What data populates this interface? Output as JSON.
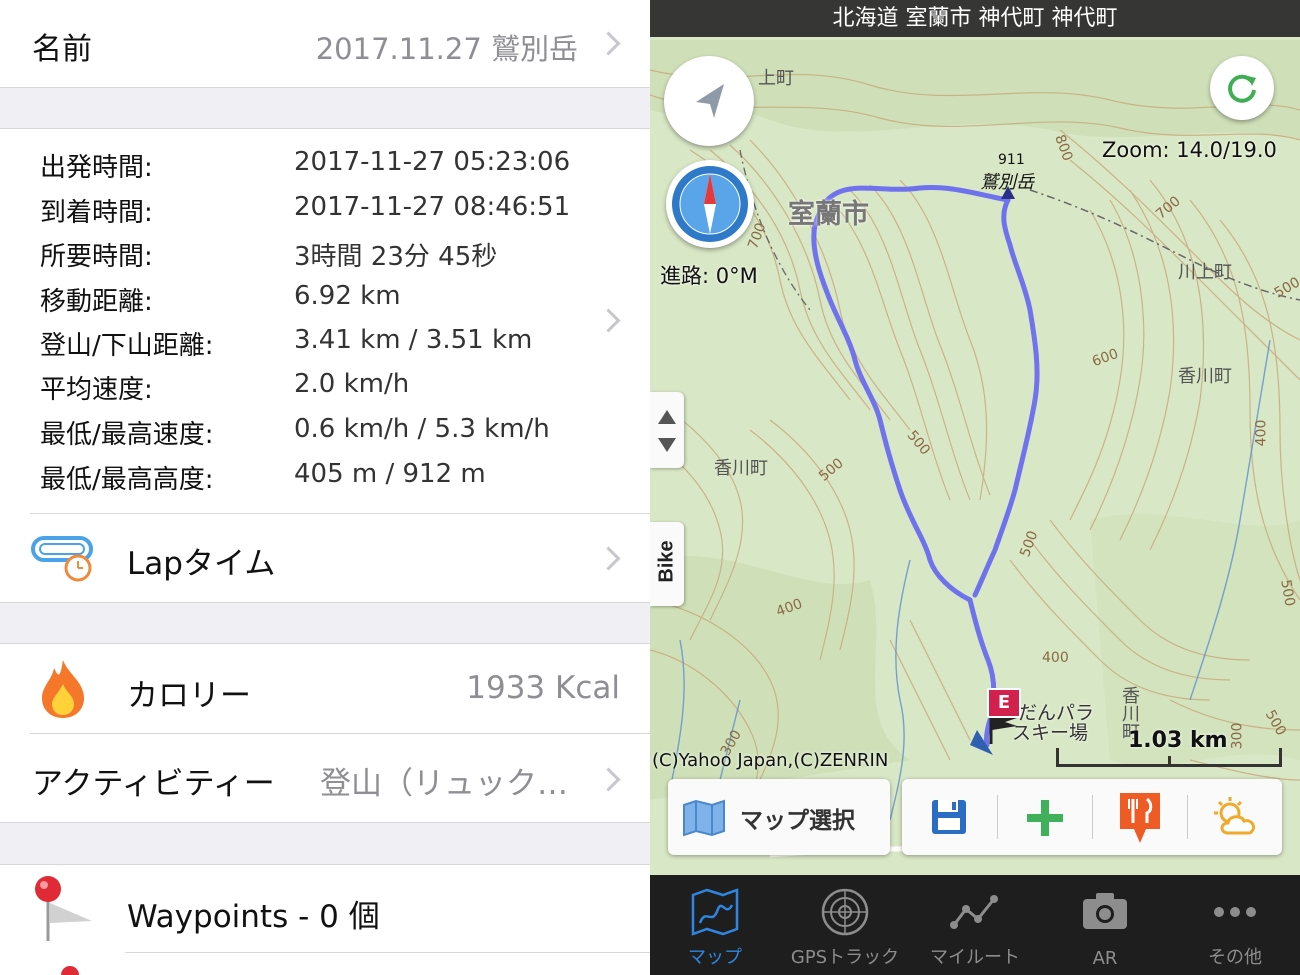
{
  "detail": {
    "name_label": "名前",
    "name_value": "2017.11.27 鷲別岳",
    "stats": [
      {
        "label": "出発時間:",
        "value": "2017-11-27 05:23:06"
      },
      {
        "label": "到着時間:",
        "value": "2017-11-27 08:46:51"
      },
      {
        "label": "所要時間:",
        "value": "3時間 23分 45秒"
      },
      {
        "label": "移動距離:",
        "value": "6.92 km"
      },
      {
        "label": "登山/下山距離:",
        "value": "3.41 km / 3.51 km"
      },
      {
        "label": "平均速度:",
        "value": "2.0 km/h"
      },
      {
        "label": "最低/最高速度:",
        "value": "0.6 km/h / 5.3 km/h"
      },
      {
        "label": "最低/最高高度:",
        "value": "405 m / 912 m"
      }
    ],
    "lap_label": "Lapタイム",
    "calorie_label": "カロリー",
    "calorie_value": "1933 Kcal",
    "activity_label": "アクティビティー",
    "activity_value": "登山（リュック…",
    "waypoints_label": "Waypoints - 0 個"
  },
  "map": {
    "address": "北海道 室蘭市 神代町 神代町",
    "zoom": "Zoom: 14.0/19.0",
    "heading": "進路: 0°M",
    "peak_elev": "911",
    "peak_name": "鷲別岳",
    "city_label": "室蘭市",
    "town_labels": [
      "上町",
      "川上町",
      "香川町",
      "香川町"
    ],
    "contours": [
      "800",
      "700",
      "700",
      "600",
      "500",
      "500",
      "500",
      "500",
      "400",
      "400",
      "300",
      "300",
      "400",
      "500",
      "500"
    ],
    "ski_label_1": "だんパラ",
    "ski_label_2": "スキー場",
    "vertical_label": "香川町",
    "scale": "1.03 km",
    "copyright": "(C)Yahoo Japan,(C)ZENRIN",
    "end_marker": "E",
    "bike_tab": "Bike",
    "map_select_label": "マップ選択"
  },
  "tabbar": {
    "items": [
      {
        "label": "マップ",
        "icon": "map-icon"
      },
      {
        "label": "GPSトラック",
        "icon": "radar-icon"
      },
      {
        "label": "マイルート",
        "icon": "route-icon"
      },
      {
        "label": "AR",
        "icon": "camera-icon"
      },
      {
        "label": "その他",
        "icon": "more-icon"
      }
    ],
    "active_color": "#2f86e0"
  },
  "colors": {
    "track": "#6a6cf0",
    "contour": "#c9a97e",
    "map_bg": "#d9e8c7"
  }
}
